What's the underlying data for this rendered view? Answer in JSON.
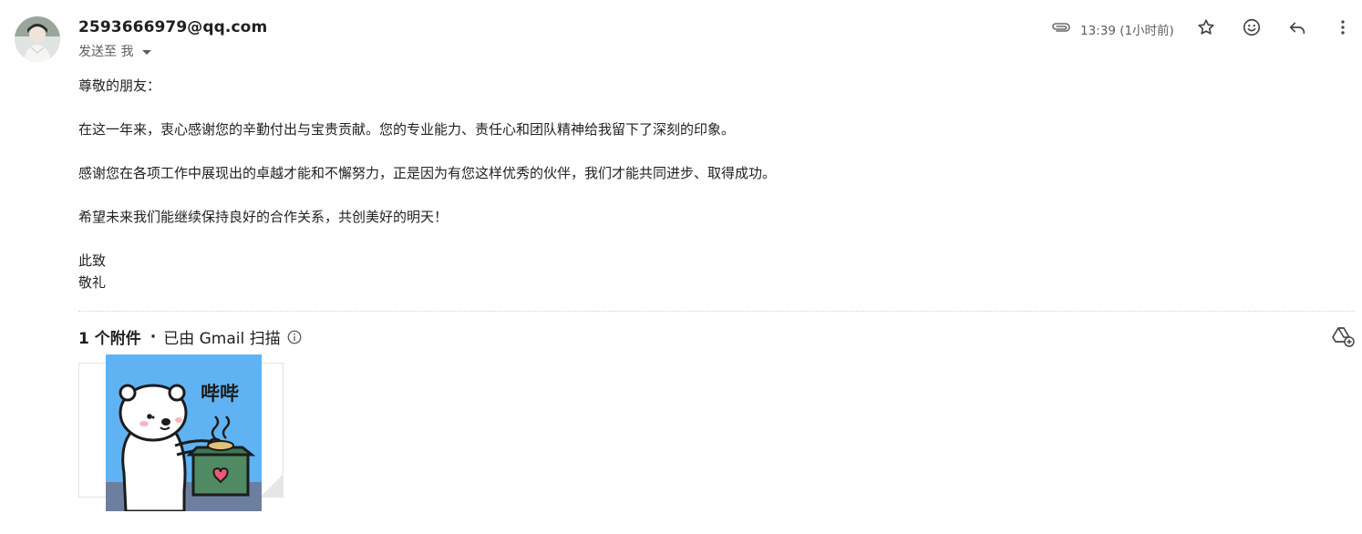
{
  "email": {
    "sender": "2593666979@qq.com",
    "to_line": "发送至 我",
    "time": "13:39 (1小时前)",
    "body": {
      "greeting": "尊敬的朋友：",
      "paragraph1": "在这一年来，衷心感谢您的辛勤付出与宝贵贡献。您的专业能力、责任心和团队精神给我留下了深刻的印象。",
      "paragraph2": "感谢您在各项工作中展现出的卓越才能和不懈努力，正是因为有您这样优秀的伙伴，我们才能共同进步、取得成功。",
      "paragraph3": "希望未来我们能继续保持良好的合作关系，共创美好的明天！",
      "closing1": "此致",
      "closing2": "敬礼"
    }
  },
  "attachments": {
    "count_label": "1 个附件",
    "separator": "·",
    "scanned_label": "已由 Gmail 扫描"
  },
  "sticker": {
    "text": "哔哔"
  },
  "icons": {
    "attachment": "paperclip-icon",
    "star": "star-icon",
    "emoji": "smiley-icon",
    "reply": "reply-icon",
    "more": "more-vert-icon",
    "info": "info-icon",
    "drive": "add-to-drive-icon",
    "dropdown": "caret-down-icon"
  },
  "colors": {
    "text_primary": "#1f1f1f",
    "text_secondary": "#5e5e5e",
    "sticker_bg": "#5fb3f2",
    "box_green": "#4f8a63"
  }
}
